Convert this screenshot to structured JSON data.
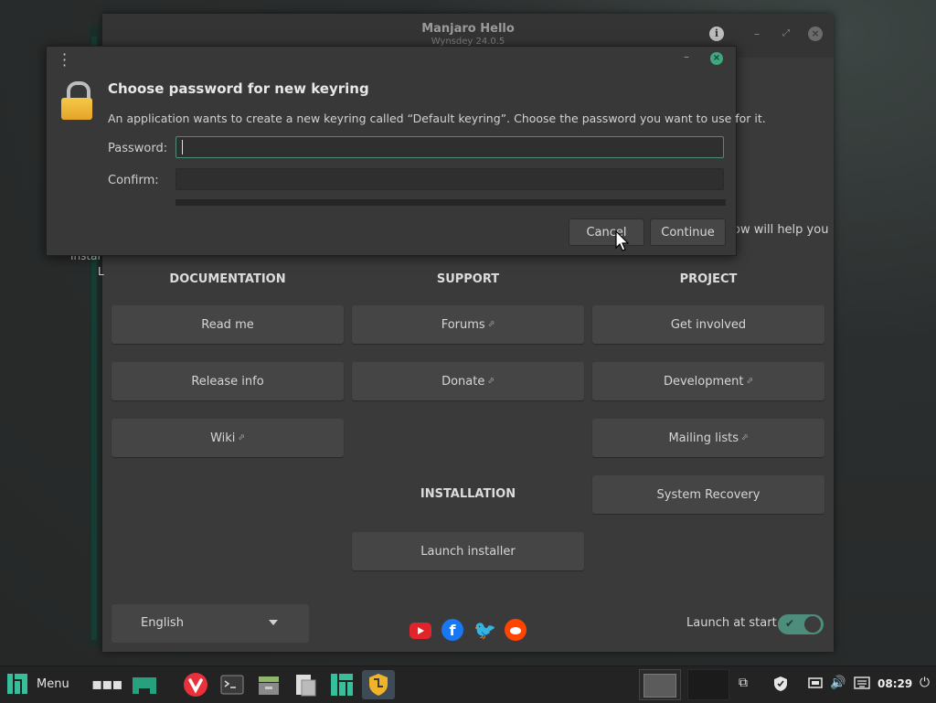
{
  "hello_window": {
    "title": "Manjaro Hello",
    "subtitle": "Wynsdey 24.0.5",
    "partial_text": "ow will help you",
    "desktop_fragment_1": "Instal",
    "desktop_fragment_2": "L",
    "sections": {
      "documentation": "DOCUMENTATION",
      "support": "SUPPORT",
      "project": "PROJECT",
      "installation": "INSTALLATION"
    },
    "buttons": {
      "read_me": "Read me",
      "release_info": "Release info",
      "wiki": "Wiki",
      "forums": "Forums",
      "donate": "Donate",
      "get_involved": "Get involved",
      "development": "Development",
      "mailing_lists": "Mailing lists",
      "system_recovery": "System Recovery",
      "launch_installer": "Launch installer"
    },
    "external_link_icon": "⬀",
    "language": {
      "selected": "English"
    },
    "launch_at_start": {
      "label": "Launch at start",
      "enabled": true
    },
    "social_icons": [
      "youtube-icon",
      "facebook-icon",
      "twitter-icon",
      "reddit-icon"
    ]
  },
  "keyring_dialog": {
    "heading": "Choose password for new keyring",
    "description": "An application wants to create a new keyring called “Default keyring”. Choose the password you want to use for it.",
    "password_label": "Password:",
    "password_value": "",
    "confirm_label": "Confirm:",
    "confirm_value": "",
    "cancel_label": "Cancel",
    "continue_label": "Continue"
  },
  "taskbar": {
    "menu_label": "Menu",
    "clock": "08:29",
    "colors": {
      "accent": "#35bf9a",
      "active_bg": "#3e4a55"
    }
  }
}
